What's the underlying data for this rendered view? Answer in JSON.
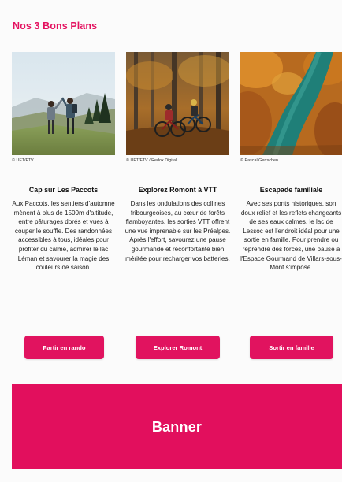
{
  "section": {
    "title": "Nos 3 Bons Plans"
  },
  "colors": {
    "accent": "#e1135f",
    "banner": "#e20f5d"
  },
  "cards": [
    {
      "credit": "© UFT/FTV",
      "title": "Cap sur Les Paccots",
      "text": "Aux Paccots, les sentiers d'automne mènent à plus de 1500m d'altitude, entre pâturages dorés et vues à couper le souffle. Des randonnées accessibles à tous, idéales pour profiter du calme, admirer le lac Léman et savourer la magie des couleurs de saison.",
      "button": "Partir en rando",
      "photo_alt": "Deux randonneurs se tapent dans la main sur une crête d'automne"
    },
    {
      "credit": "© UFT/FTV / Redox Digital",
      "title": "Explorez Romont à VTT",
      "text": "Dans les ondulations des collines fribourgeoises, au cœur de forêts flamboyantes, les sorties VTT offrent une vue imprenable sur les Préalpes. Après l'effort, savourez une pause gourmande et réconfortante bien méritée pour recharger vos batteries.",
      "button": "Explorer Romont",
      "photo_alt": "Deux vététistes en forêt d'automne"
    },
    {
      "credit": "© Pascal Gertschen",
      "title": "Escapade familiale",
      "text": "Avec ses ponts historiques, son doux relief et les reflets changeants de ses eaux calmes, le lac de Lessoc est l'endroit idéal pour une sortie en famille. Pour prendre ou reprendre des forces, une pause à l'Espace Gourmand de Villars-sous-Mont s'impose.",
      "button": "Sortir en famille",
      "photo_alt": "Rivière turquoise entre des rives boisées automnales"
    }
  ],
  "banner": {
    "label": "Banner"
  }
}
